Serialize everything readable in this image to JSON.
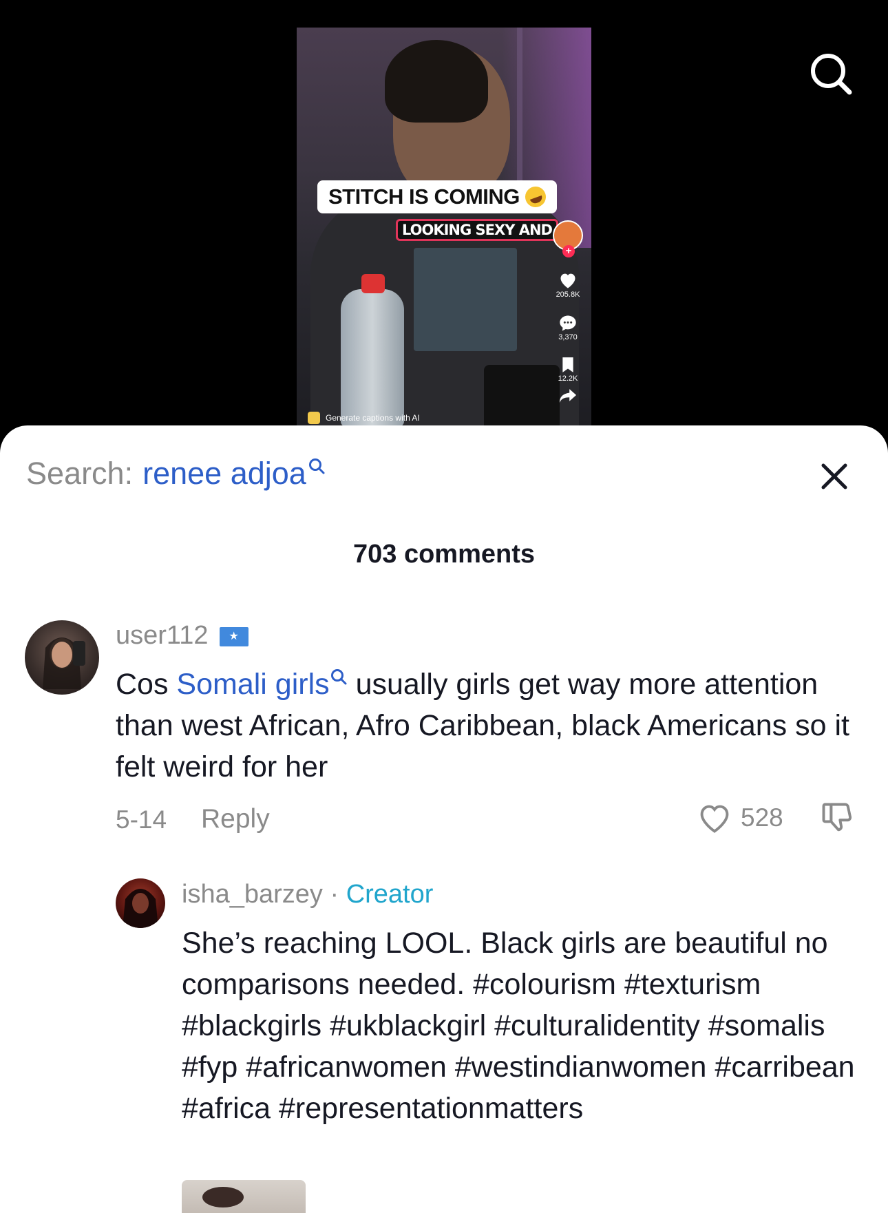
{
  "video": {
    "caption": "STITCH IS COMING",
    "subcaption": "LOOKING SEXY AND",
    "likes": "205.8K",
    "comments": "3,370",
    "saves": "12.2K",
    "ai_label": "Generate captions with AI"
  },
  "sheet": {
    "search_prefix": "Search:",
    "search_term": "renee adjoa",
    "comments_count": "703 comments"
  },
  "comments": [
    {
      "username": "user112",
      "text_before": "Cos ",
      "text_link": "Somali girls",
      "text_after": " usually girls get way more attention than west African, Afro Caribbean, black Americans so it felt weird for her",
      "date": "5-14",
      "reply_label": "Reply",
      "likes": "528"
    }
  ],
  "reply": {
    "username": "isha_barzey",
    "separator": "·",
    "badge": "Creator",
    "text": "She’s reaching LOOL. Black girls are beautiful no comparisons needed. #colourism #texturism #blackgirls #ukblackgirl #culturalidentity #somalis #fyp #africanwomen #westindianwomen #carribean #africa #representationmatters"
  },
  "colors": {
    "link": "#2d5ec8",
    "creator": "#20a5cc",
    "muted": "#8a8a8a",
    "text": "#161823"
  }
}
